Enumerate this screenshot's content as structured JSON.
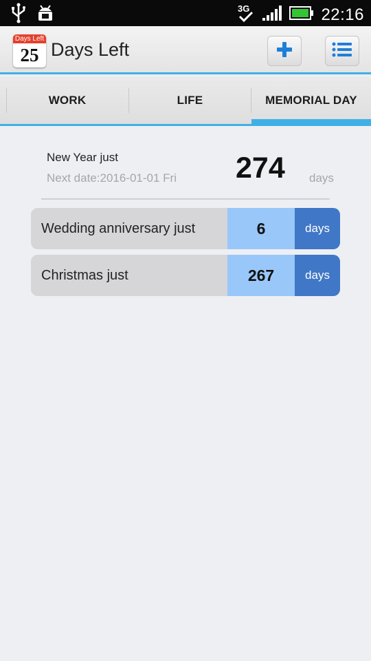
{
  "status": {
    "time": "22:16",
    "network": "3G"
  },
  "app": {
    "icon_top": "Days Left",
    "icon_num": "25",
    "title": "Days Left",
    "icons": {
      "add": "plus-icon",
      "menu": "list-icon"
    }
  },
  "tabs": [
    {
      "label": "WORK"
    },
    {
      "label": "LIFE"
    },
    {
      "label": "MEMORIAL DAY",
      "selected": true
    }
  ],
  "featured": {
    "title": "New Year just",
    "next_date": "Next date:2016-01-01 Fri",
    "count": "274",
    "unit": "days"
  },
  "events": [
    {
      "label": "Wedding anniversary just",
      "count": "6",
      "unit": "days"
    },
    {
      "label": "Christmas just",
      "count": "267",
      "unit": "days"
    }
  ],
  "colors": {
    "accent": "#3fb0e6",
    "count_bg": "#99c7f9",
    "unit_bg": "#4077c6",
    "icon_red": "#e4402c",
    "battery_green": "#34c534"
  }
}
